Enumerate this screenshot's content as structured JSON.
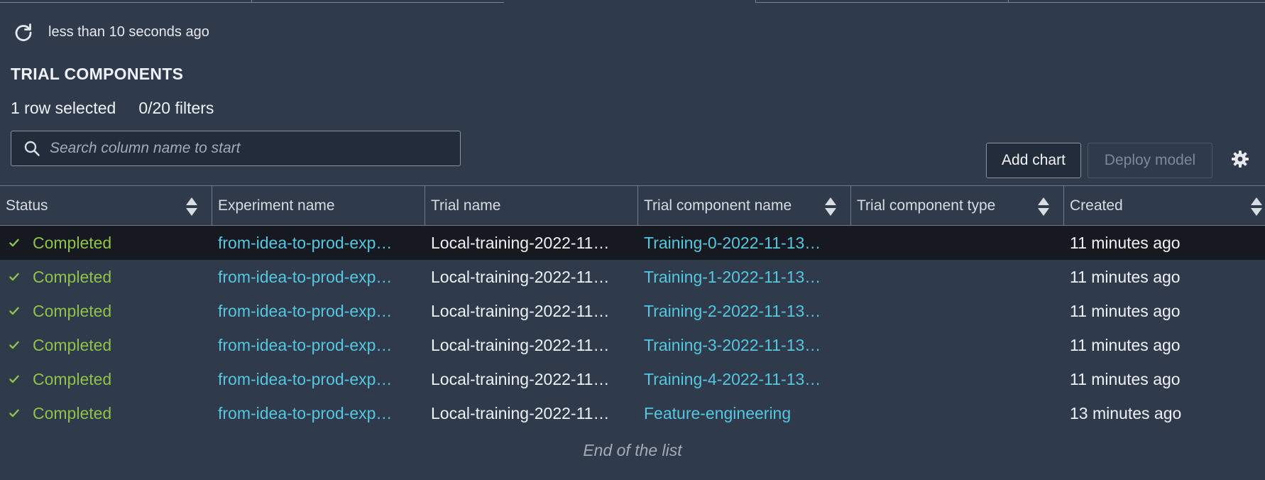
{
  "refresh": {
    "icon": "refresh-icon",
    "status_text": "less than 10 seconds ago"
  },
  "section": {
    "title": "TRIAL COMPONENTS",
    "rows_selected": "1 row selected",
    "filters": "0/20 filters"
  },
  "search": {
    "placeholder": "Search column name to start",
    "value": ""
  },
  "toolbar": {
    "add_chart_label": "Add chart",
    "deploy_model_label": "Deploy model"
  },
  "table": {
    "columns": [
      {
        "label": "Status",
        "sortable": true
      },
      {
        "label": "Experiment name",
        "sortable": false
      },
      {
        "label": "Trial name",
        "sortable": false
      },
      {
        "label": "Trial component name",
        "sortable": true
      },
      {
        "label": "Trial component type",
        "sortable": true
      },
      {
        "label": "Created",
        "sortable": true
      }
    ],
    "rows": [
      {
        "status": "Completed",
        "experiment": "from-idea-to-prod-exp…",
        "trial": "Local-training-2022-11…",
        "component": "Training-0-2022-11-13…",
        "type": "",
        "created": "11 minutes ago",
        "selected": true
      },
      {
        "status": "Completed",
        "experiment": "from-idea-to-prod-exp…",
        "trial": "Local-training-2022-11…",
        "component": "Training-1-2022-11-13…",
        "type": "",
        "created": "11 minutes ago",
        "selected": false
      },
      {
        "status": "Completed",
        "experiment": "from-idea-to-prod-exp…",
        "trial": "Local-training-2022-11…",
        "component": "Training-2-2022-11-13…",
        "type": "",
        "created": "11 minutes ago",
        "selected": false
      },
      {
        "status": "Completed",
        "experiment": "from-idea-to-prod-exp…",
        "trial": "Local-training-2022-11…",
        "component": "Training-3-2022-11-13…",
        "type": "",
        "created": "11 minutes ago",
        "selected": false
      },
      {
        "status": "Completed",
        "experiment": "from-idea-to-prod-exp…",
        "trial": "Local-training-2022-11…",
        "component": "Training-4-2022-11-13…",
        "type": "",
        "created": "11 minutes ago",
        "selected": false
      },
      {
        "status": "Completed",
        "experiment": "from-idea-to-prod-exp…",
        "trial": "Local-training-2022-11…",
        "component": "Feature-engineering",
        "type": "",
        "created": "13 minutes ago",
        "selected": false
      }
    ],
    "end_note": "End of the list"
  },
  "colors": {
    "background": "#2f3a4b",
    "selected_row": "#16191f",
    "status_green": "#8ec24b",
    "link_blue": "#56c6e2"
  }
}
